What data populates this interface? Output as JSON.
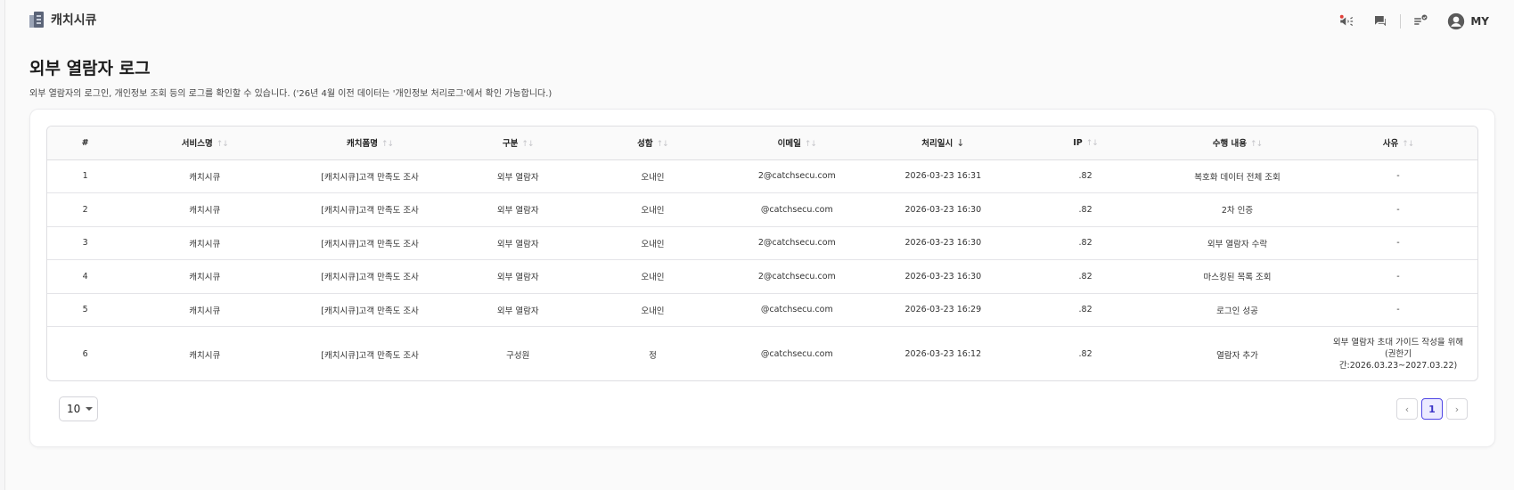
{
  "brand": {
    "name": "캐치시큐"
  },
  "user": {
    "label": "MY"
  },
  "page": {
    "title": "외부 열람자 로그",
    "description": "외부 열람자의 로그인, 개인정보 조회 등의 로그를 확인할 수 있습니다. ('26년 4월 이전 데이터는 '개인정보 처리로그'에서 확인 가능합니다.)"
  },
  "table": {
    "columns": [
      "#",
      "서비스명",
      "캐치폼명",
      "구분",
      "성함",
      "이메일",
      "처리일시",
      "IP",
      "수행 내용",
      "사유"
    ],
    "sort_glyph": "↑↓",
    "active_sort_glyph": "↓",
    "rows": [
      {
        "no": "1",
        "service": "캐치시큐",
        "form": "[캐치시큐]고객 만족도 조사",
        "type": "외부 열람자",
        "name": "오내인",
        "email": "2@catchsecu.com",
        "datetime": "2026-03-23 16:31",
        "ip": ".82",
        "action": "복호화 데이터 전체 조회",
        "reason": "-"
      },
      {
        "no": "2",
        "service": "캐치시큐",
        "form": "[캐치시큐]고객 만족도 조사",
        "type": "외부 열람자",
        "name": "오내인",
        "email": "@catchsecu.com",
        "datetime": "2026-03-23 16:30",
        "ip": ".82",
        "action": "2차 인증",
        "reason": "-"
      },
      {
        "no": "3",
        "service": "캐치시큐",
        "form": "[캐치시큐]고객 만족도 조사",
        "type": "외부 열람자",
        "name": "오내인",
        "email": "2@catchsecu.com",
        "datetime": "2026-03-23 16:30",
        "ip": ".82",
        "action": "외부 열람자 수락",
        "reason": "-"
      },
      {
        "no": "4",
        "service": "캐치시큐",
        "form": "[캐치시큐]고객 만족도 조사",
        "type": "외부 열람자",
        "name": "오내인",
        "email": "2@catchsecu.com",
        "datetime": "2026-03-23 16:30",
        "ip": ".82",
        "action": "마스킹된 목록 조회",
        "reason": "-"
      },
      {
        "no": "5",
        "service": "캐치시큐",
        "form": "[캐치시큐]고객 만족도 조사",
        "type": "외부 열람자",
        "name": "오내인",
        "email": "@catchsecu.com",
        "datetime": "2026-03-23 16:29",
        "ip": ".82",
        "action": "로그인 성공",
        "reason": "-"
      },
      {
        "no": "6",
        "service": "캐치시큐",
        "form": "[캐치시큐]고객 만족도 조사",
        "type": "구성원",
        "name": "정",
        "email": "@catchsecu.com",
        "datetime": "2026-03-23 16:12",
        "ip": ".82",
        "action": "열람자 추가",
        "reason": "외부 열람자 초대 가이드 작성을 위해(권한기간:2026.03.23~2027.03.22)"
      }
    ]
  },
  "pagination": {
    "page_size": "10",
    "prev_label": "‹",
    "next_label": "›",
    "current_page": "1"
  },
  "colors": {
    "accent": "#4f46e5"
  }
}
